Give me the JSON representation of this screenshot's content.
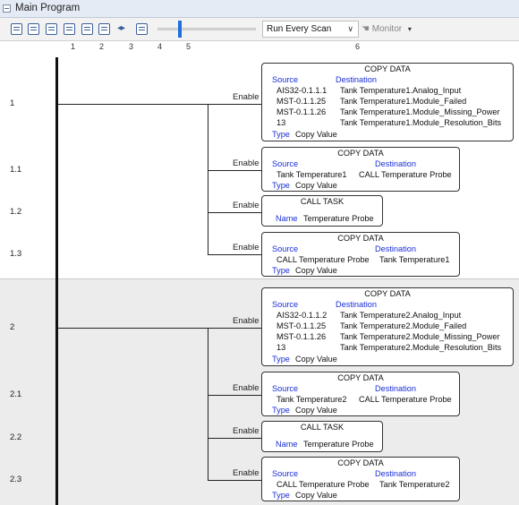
{
  "window": {
    "title": "Main Program"
  },
  "toolbar": {
    "run_mode": "Run Every Scan",
    "monitor_label": "Monitor",
    "buttons": [
      "Insert Rung",
      "Edit",
      "Copy",
      "Text",
      "List",
      "Delete",
      "Move",
      "Save"
    ]
  },
  "ruler": [
    "1",
    "2",
    "3",
    "4",
    "5",
    "6"
  ],
  "labels": {
    "enable": "Enable",
    "source": "Source",
    "destination": "Destination",
    "type": "Type",
    "name": "Name"
  },
  "rungs": [
    {
      "label": "1",
      "block": {
        "title": "COPY DATA",
        "rows": [
          [
            "AIS32-0.1.1.1",
            "Tank Temperature1.Analog_Input"
          ],
          [
            "MST-0.1.1.25",
            "Tank Temperature1.Module_Failed"
          ],
          [
            "MST-0.1.1.26",
            "Tank Temperature1.Module_Missing_Power"
          ],
          [
            "13",
            "Tank Temperature1.Module_Resolution_Bits"
          ]
        ],
        "type_value": "Copy Value"
      }
    },
    {
      "label": "1.1",
      "block": {
        "title": "COPY DATA",
        "src": "Tank Temperature1",
        "dest": "CALL Temperature Probe",
        "type_value": "Copy Value"
      }
    },
    {
      "label": "1.2",
      "block": {
        "title": "CALL TASK",
        "name_value": "Temperature Probe"
      }
    },
    {
      "label": "1.3",
      "block": {
        "title": "COPY DATA",
        "src": "CALL Temperature Probe",
        "dest": "Tank Temperature1",
        "type_value": "Copy Value"
      }
    },
    {
      "label": "2",
      "block": {
        "title": "COPY DATA",
        "rows": [
          [
            "AIS32-0.1.1.2",
            "Tank Temperature2.Analog_Input"
          ],
          [
            "MST-0.1.1.25",
            "Tank Temperature2.Module_Failed"
          ],
          [
            "MST-0.1.1.26",
            "Tank Temperature2.Module_Missing_Power"
          ],
          [
            "13",
            "Tank Temperature2.Module_Resolution_Bits"
          ]
        ],
        "type_value": "Copy Value"
      }
    },
    {
      "label": "2.1",
      "block": {
        "title": "COPY DATA",
        "src": "Tank Temperature2",
        "dest": "CALL Temperature Probe",
        "type_value": "Copy Value"
      }
    },
    {
      "label": "2.2",
      "block": {
        "title": "CALL TASK",
        "name_value": "Temperature Probe"
      }
    },
    {
      "label": "2.3",
      "block": {
        "title": "COPY DATA",
        "src": "CALL Temperature Probe",
        "dest": "Tank Temperature2",
        "type_value": "Copy Value"
      }
    }
  ]
}
